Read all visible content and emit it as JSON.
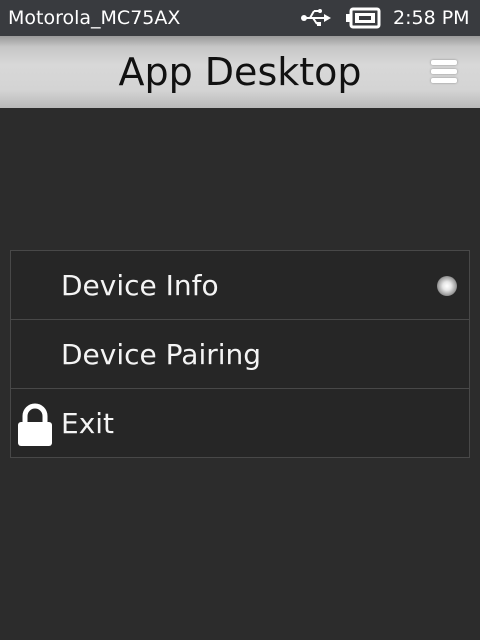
{
  "status_bar": {
    "device_name": "Motorola_MC75AX",
    "usb_icon": "usb-icon",
    "battery_icon": "battery-charging-icon",
    "time": "2:58 PM"
  },
  "header": {
    "title": "App Desktop",
    "menu_icon": "hamburger-menu-icon"
  },
  "menu": {
    "items": [
      {
        "label": "Device Info",
        "trailing_icon": "indicator-dot"
      },
      {
        "label": "Device Pairing"
      },
      {
        "label": "Exit",
        "leading_icon": "lock-icon"
      }
    ]
  },
  "colors": {
    "background": "#2c2c2c",
    "status_bar": "#393b3f",
    "header_gradient": "#d4d4d4",
    "list_background": "#262626",
    "text": "#f4f4f4"
  }
}
